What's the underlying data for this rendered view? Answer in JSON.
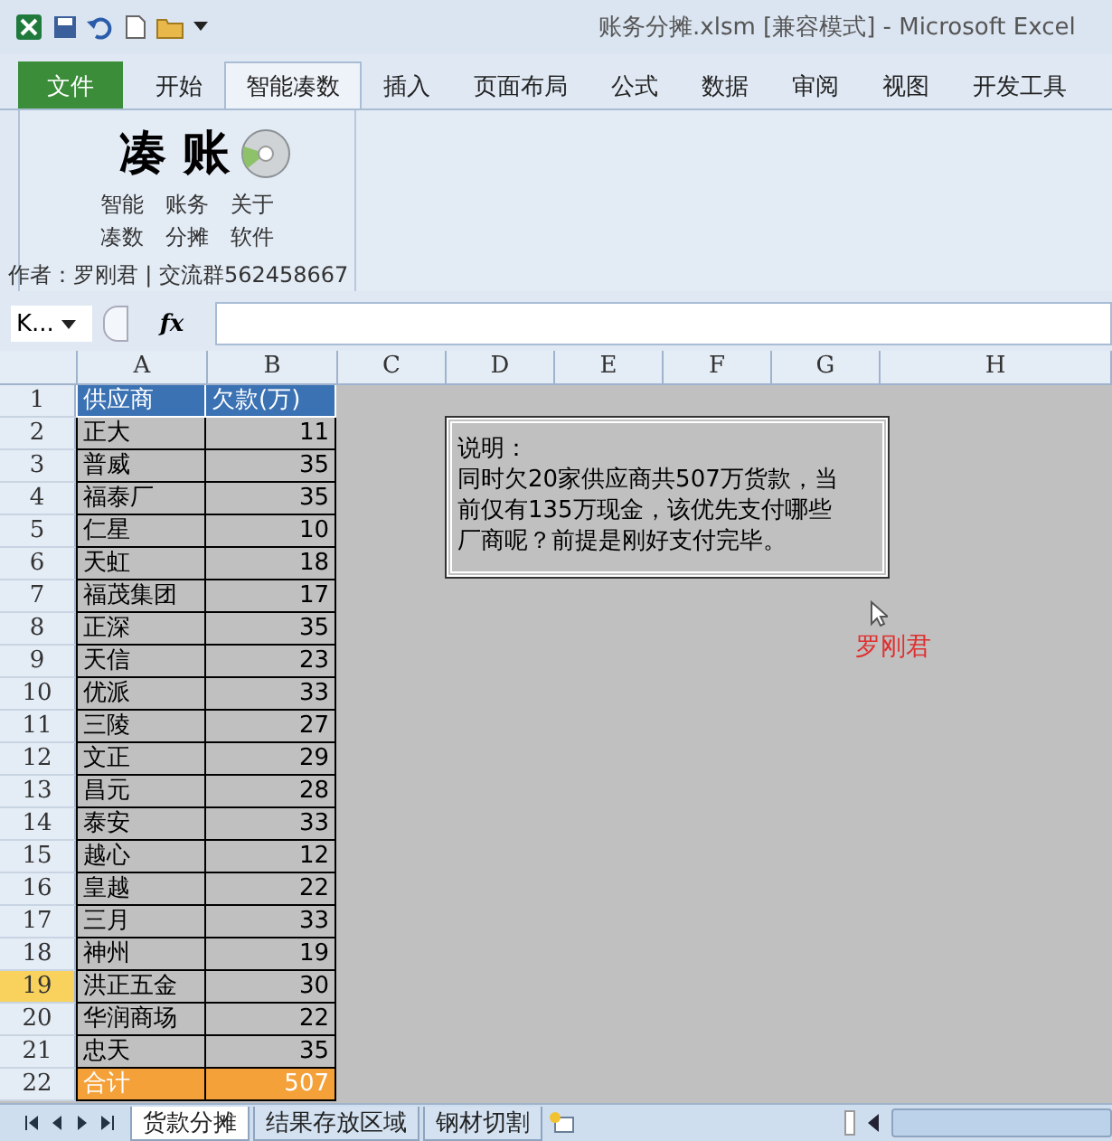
{
  "window": {
    "title": "账务分摊.xlsm  [兼容模式]  -  Microsoft Excel"
  },
  "ribbon_tabs": [
    {
      "label": "文件",
      "selected": false,
      "kind": "file"
    },
    {
      "label": "开始",
      "selected": false,
      "kind": "tab"
    },
    {
      "label": "智能凑数",
      "selected": true,
      "kind": "tab"
    },
    {
      "label": "插入",
      "selected": false,
      "kind": "tab"
    },
    {
      "label": "页面布局",
      "selected": false,
      "kind": "tab"
    },
    {
      "label": "公式",
      "selected": false,
      "kind": "tab"
    },
    {
      "label": "数据",
      "selected": false,
      "kind": "tab"
    },
    {
      "label": "审阅",
      "selected": false,
      "kind": "tab"
    },
    {
      "label": "视图",
      "selected": false,
      "kind": "tab"
    },
    {
      "label": "开发工具",
      "selected": false,
      "kind": "tab"
    }
  ],
  "ribbon_group": {
    "logo_text": "凑 账",
    "buttons": [
      {
        "lines": [
          "智能",
          "凑数"
        ]
      },
      {
        "lines": [
          "账务",
          "分摊"
        ]
      },
      {
        "lines": [
          "关于",
          "软件"
        ]
      }
    ],
    "label": "作者：罗刚君 | 交流群562458667"
  },
  "formula_bar": {
    "name_box": "K...",
    "function_label": "fx"
  },
  "columns": [
    "A",
    "B",
    "C",
    "D",
    "E",
    "F",
    "G",
    "H"
  ],
  "rows": [
    {
      "number": "1",
      "selected": false,
      "kind": "header",
      "cells": [
        "供应商",
        "欠款(万)"
      ]
    },
    {
      "number": "2",
      "selected": false,
      "kind": "data",
      "cells": [
        "正大",
        "11"
      ]
    },
    {
      "number": "3",
      "selected": false,
      "kind": "data",
      "cells": [
        "普威",
        "35"
      ]
    },
    {
      "number": "4",
      "selected": false,
      "kind": "data",
      "cells": [
        "福泰厂",
        "35"
      ]
    },
    {
      "number": "5",
      "selected": false,
      "kind": "data",
      "cells": [
        "仁星",
        "10"
      ]
    },
    {
      "number": "6",
      "selected": false,
      "kind": "data",
      "cells": [
        "天虹",
        "18"
      ]
    },
    {
      "number": "7",
      "selected": false,
      "kind": "data",
      "cells": [
        "福茂集团",
        "17"
      ]
    },
    {
      "number": "8",
      "selected": false,
      "kind": "data",
      "cells": [
        "正深",
        "35"
      ]
    },
    {
      "number": "9",
      "selected": false,
      "kind": "data",
      "cells": [
        "天信",
        "23"
      ]
    },
    {
      "number": "10",
      "selected": false,
      "kind": "data",
      "cells": [
        "优派",
        "33"
      ]
    },
    {
      "number": "11",
      "selected": false,
      "kind": "data",
      "cells": [
        "三陵",
        "27"
      ]
    },
    {
      "number": "12",
      "selected": false,
      "kind": "data",
      "cells": [
        "文正",
        "29"
      ]
    },
    {
      "number": "13",
      "selected": false,
      "kind": "data",
      "cells": [
        "昌元",
        "28"
      ]
    },
    {
      "number": "14",
      "selected": false,
      "kind": "data",
      "cells": [
        "泰安",
        "33"
      ]
    },
    {
      "number": "15",
      "selected": false,
      "kind": "data",
      "cells": [
        "越心",
        "12"
      ]
    },
    {
      "number": "16",
      "selected": false,
      "kind": "data",
      "cells": [
        "皇越",
        "22"
      ]
    },
    {
      "number": "17",
      "selected": false,
      "kind": "data",
      "cells": [
        "三月",
        "33"
      ]
    },
    {
      "number": "18",
      "selected": false,
      "kind": "data",
      "cells": [
        "神州",
        "19"
      ]
    },
    {
      "number": "19",
      "selected": true,
      "kind": "data",
      "cells": [
        "洪正五金",
        "30"
      ]
    },
    {
      "number": "20",
      "selected": false,
      "kind": "data",
      "cells": [
        "华润商场",
        "22"
      ]
    },
    {
      "number": "21",
      "selected": false,
      "kind": "data",
      "cells": [
        "忠天",
        "35"
      ]
    },
    {
      "number": "22",
      "selected": false,
      "kind": "total",
      "cells": [
        "合计",
        "507"
      ]
    }
  ],
  "note_box": {
    "heading": "说明：",
    "lines": [
      "同时欠20家供应商共507万货款，当",
      "前仅有135万现金，该优先支付哪些",
      "厂商呢？前提是刚好支付完毕。"
    ]
  },
  "author_label": "罗刚君",
  "sheet_tabs": [
    {
      "label": "货款分摊",
      "selected": true
    },
    {
      "label": "结果存放区域",
      "selected": false
    },
    {
      "label": "钢材切割",
      "selected": false
    }
  ]
}
